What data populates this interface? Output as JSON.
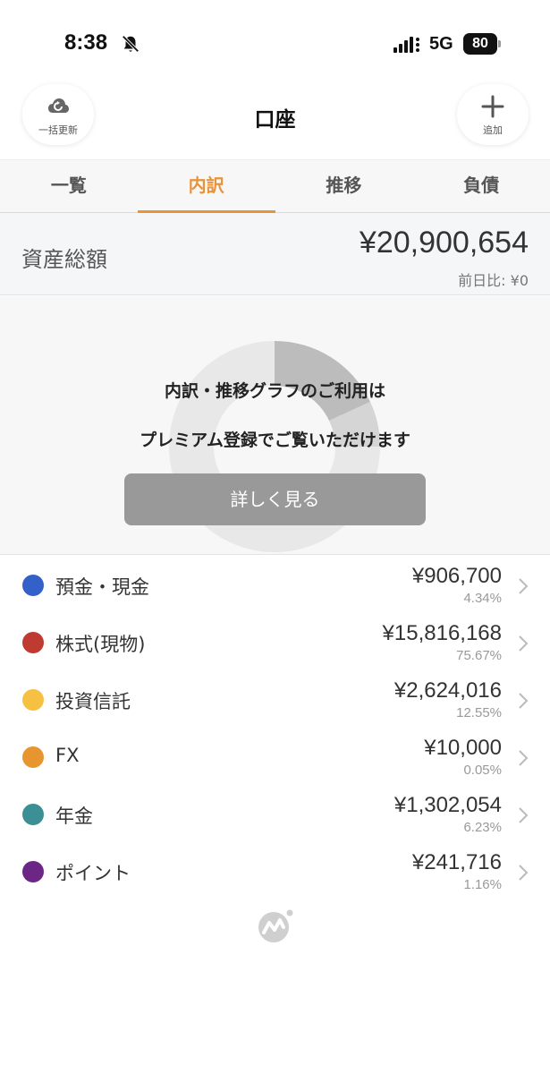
{
  "status_bar": {
    "time": "8:38",
    "network": "5G",
    "battery": "80",
    "icons": [
      "bell-slash-icon",
      "signal-icon",
      "battery-icon"
    ]
  },
  "header": {
    "title": "口座",
    "refresh_label": "一括更新",
    "add_label": "追加",
    "icons": [
      "cloud-refresh-icon",
      "plus-icon"
    ]
  },
  "tabs": [
    {
      "label": "一覧",
      "active": false
    },
    {
      "label": "内訳",
      "active": true
    },
    {
      "label": "推移",
      "active": false
    },
    {
      "label": "負債",
      "active": false
    }
  ],
  "total": {
    "label": "資産総額",
    "value": "¥20,900,654",
    "diff": "前日比: ¥0"
  },
  "premium": {
    "line1": "内訳・推移グラフのご利用は",
    "line2": "プレミアム登録でご覧いただけます",
    "button": "詳しく見る"
  },
  "assets": [
    {
      "name": "預金・現金",
      "amount": "¥906,700",
      "pct": "4.34%",
      "color": "#3461c9"
    },
    {
      "name": "株式(現物)",
      "amount": "¥15,816,168",
      "pct": "75.67%",
      "color": "#bf3a30"
    },
    {
      "name": "投資信託",
      "amount": "¥2,624,016",
      "pct": "12.55%",
      "color": "#f6c142"
    },
    {
      "name": "FX",
      "amount": "¥10,000",
      "pct": "0.05%",
      "color": "#e7962f"
    },
    {
      "name": "年金",
      "amount": "¥1,302,054",
      "pct": "6.23%",
      "color": "#3d8f96"
    },
    {
      "name": "ポイント",
      "amount": "¥241,716",
      "pct": "1.16%",
      "color": "#6c2685"
    }
  ],
  "colors": {
    "accent": "#e8943a",
    "button_gray": "#999999"
  }
}
